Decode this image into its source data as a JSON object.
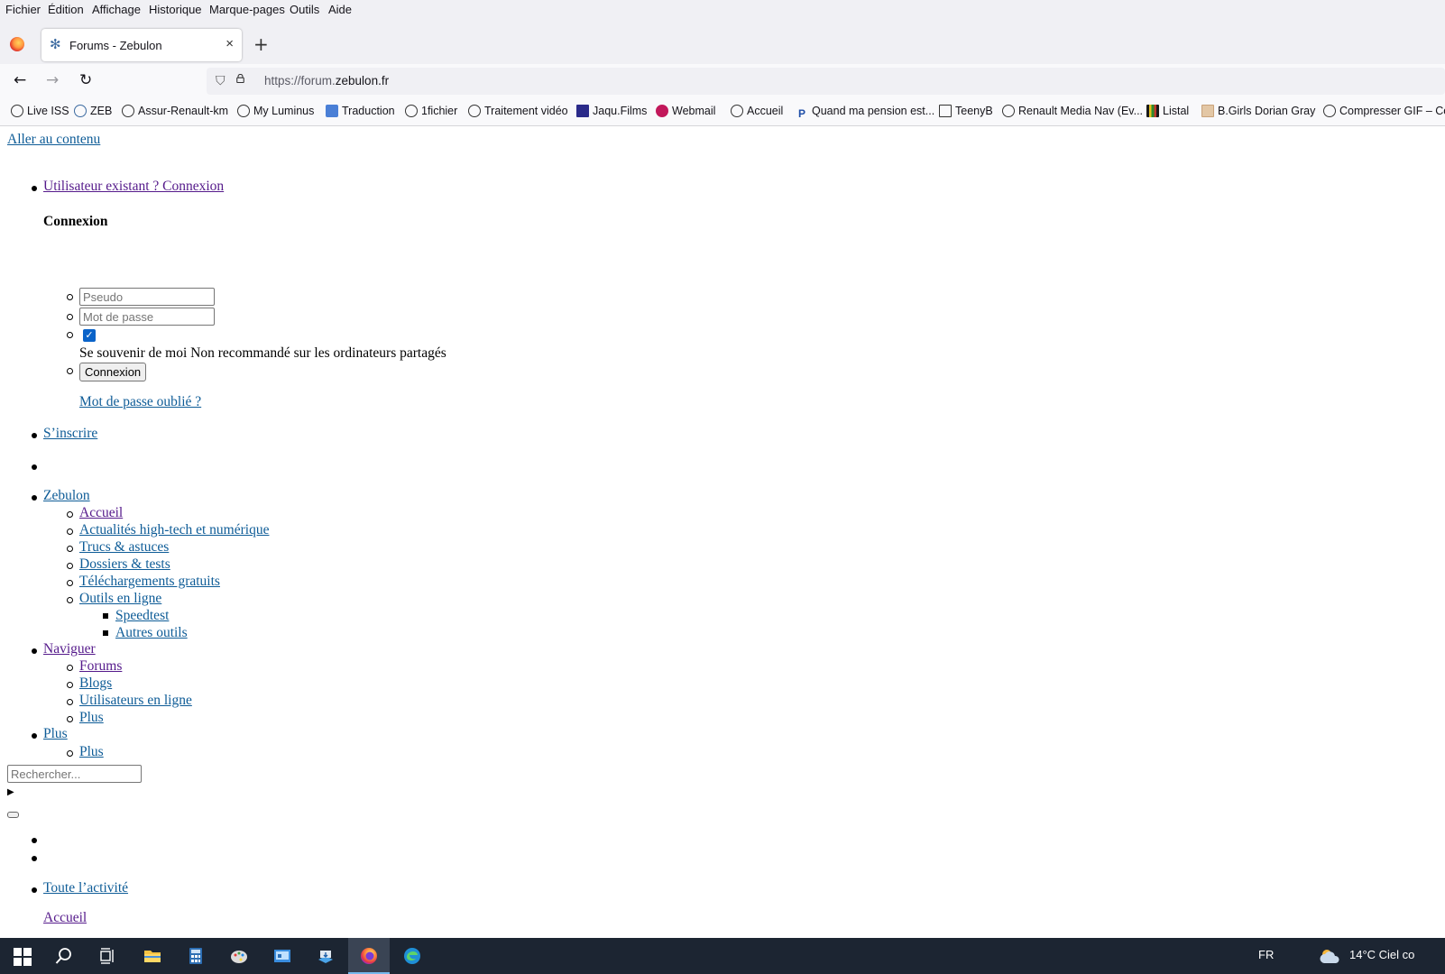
{
  "menubar": {
    "items": [
      "Fichier",
      "Édition",
      "Affichage",
      "Historique",
      "Marque-pages",
      "Outils",
      "Aide"
    ]
  },
  "tab": {
    "title": "Forums - Zebulon",
    "close": "×"
  },
  "newtab": "+",
  "navbar": {
    "back": "←",
    "forward": "→",
    "reload": "↻",
    "url_prefix": "https://forum.",
    "url_domain": "zebulon.fr"
  },
  "bookmarks": [
    "Live ISS",
    "ZEB",
    "Assur-Renault-km",
    "My Luminus",
    "Traduction",
    "1fichier",
    "Traitement vidéo",
    "Jaqu.Films",
    "Webmail",
    "Accueil",
    "Quand ma pension est...",
    "TeenyB",
    "Renault Media Nav (Ev...",
    "Listal",
    "B.Girls Dorian Gray",
    "Compresser GIF – Co..."
  ],
  "page": {
    "skip_link": "Aller au contenu",
    "login_link": "Utilisateur existant ? Connexion",
    "login_heading": "Connexion",
    "username_placeholder": "Pseudo",
    "password_placeholder": "Mot de passe",
    "remember_text": "Se souvenir de moi Non recommandé sur les ordinateurs partagés",
    "login_button": "Connexion",
    "forgot_link": "Mot de passe oublié ?",
    "register_link": "S’inscrire",
    "menu": {
      "zebulon": "Zebulon",
      "zebulon_items": [
        "Accueil",
        "Actualités high-tech et numérique",
        "Trucs & astuces",
        "Dossiers & tests",
        "Téléchargements gratuits",
        "Outils en ligne"
      ],
      "tools_items": [
        "Speedtest",
        "Autres outils"
      ],
      "naviguer": "Naviguer",
      "naviguer_items": [
        "Forums",
        "Blogs",
        "Utilisateurs en ligne",
        "Plus"
      ],
      "plus": "Plus",
      "plus_items": [
        "Plus"
      ]
    },
    "search_placeholder": "Rechercher...",
    "activity_link": "Toute l’activité",
    "partial_link": "Accueil"
  },
  "taskbar": {
    "language": "FR",
    "weather": "14°C  Ciel co"
  }
}
